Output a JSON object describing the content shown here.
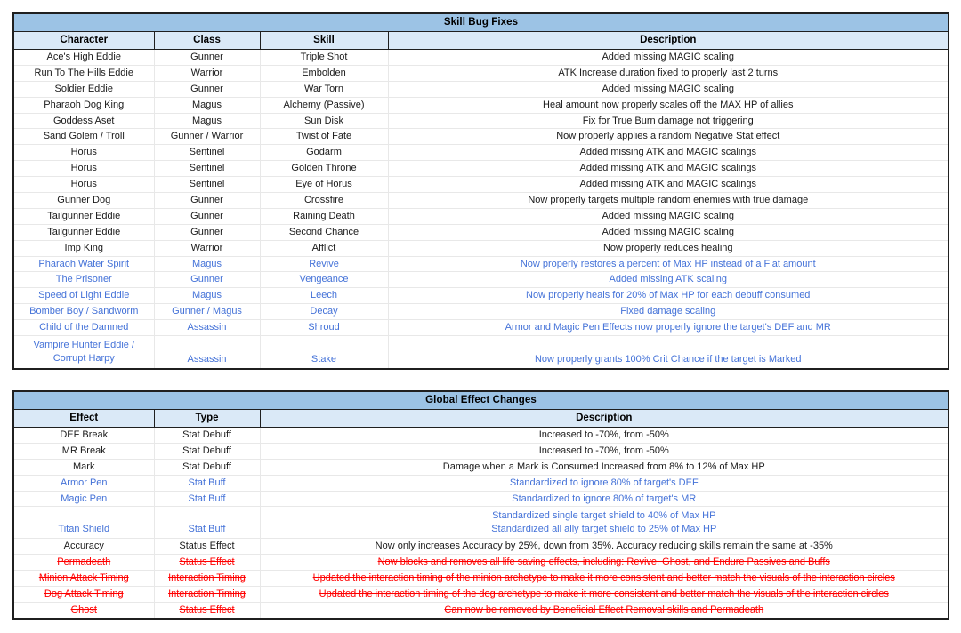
{
  "skill_bug_fixes": {
    "title": "Skill Bug Fixes",
    "columns": [
      "Character",
      "Class",
      "Skill",
      "Description"
    ],
    "rows": [
      {
        "character": "Ace's High Eddie",
        "class": "Gunner",
        "skill": "Triple Shot",
        "description": "Added missing MAGIC scaling",
        "style": "normal"
      },
      {
        "character": "Run To The Hills Eddie",
        "class": "Warrior",
        "skill": "Embolden",
        "description": "ATK Increase duration fixed to properly last 2 turns",
        "style": "normal"
      },
      {
        "character": "Soldier Eddie",
        "class": "Gunner",
        "skill": "War Torn",
        "description": "Added missing MAGIC scaling",
        "style": "normal"
      },
      {
        "character": "Pharaoh Dog King",
        "class": "Magus",
        "skill": "Alchemy (Passive)",
        "description": "Heal amount now properly scales off the MAX HP of allies",
        "style": "normal"
      },
      {
        "character": "Goddess Aset",
        "class": "Magus",
        "skill": "Sun Disk",
        "description": "Fix for True Burn damage not triggering",
        "style": "normal"
      },
      {
        "character": "Sand Golem / Troll",
        "class": "Gunner / Warrior",
        "skill": "Twist of Fate",
        "description": "Now properly applies a random Negative Stat effect",
        "style": "normal"
      },
      {
        "character": "Horus",
        "class": "Sentinel",
        "skill": "Godarm",
        "description": "Added missing ATK and MAGIC scalings",
        "style": "normal"
      },
      {
        "character": "Horus",
        "class": "Sentinel",
        "skill": "Golden Throne",
        "description": "Added missing ATK and MAGIC scalings",
        "style": "normal"
      },
      {
        "character": "Horus",
        "class": "Sentinel",
        "skill": "Eye of Horus",
        "description": "Added missing ATK and MAGIC scalings",
        "style": "normal"
      },
      {
        "character": "Gunner Dog",
        "class": "Gunner",
        "skill": "Crossfire",
        "description": "Now properly targets multiple random enemies with true damage",
        "style": "normal"
      },
      {
        "character": "Tailgunner Eddie",
        "class": "Gunner",
        "skill": "Raining Death",
        "description": "Added missing MAGIC scaling",
        "style": "normal"
      },
      {
        "character": "Tailgunner Eddie",
        "class": "Gunner",
        "skill": "Second Chance",
        "description": "Added missing MAGIC scaling",
        "style": "normal"
      },
      {
        "character": "Imp King",
        "class": "Warrior",
        "skill": "Afflict",
        "description": "Now properly reduces healing",
        "style": "normal"
      },
      {
        "character": "Pharaoh Water Spirit",
        "class": "Magus",
        "skill": "Revive",
        "description": "Now properly restores a percent of Max HP instead of a Flat amount",
        "style": "blue"
      },
      {
        "character": "The Prisoner",
        "class": "Gunner",
        "skill": "Vengeance",
        "description": "Added missing ATK scaling",
        "style": "blue"
      },
      {
        "character": "Speed of Light Eddie",
        "class": "Magus",
        "skill": "Leech",
        "description": "Now properly heals for 20% of Max HP for each debuff consumed",
        "style": "blue"
      },
      {
        "character": "Bomber Boy / Sandworm",
        "class": "Gunner / Magus",
        "skill": "Decay",
        "description": "Fixed damage scaling",
        "style": "blue"
      },
      {
        "character": "Child of the Damned",
        "class": "Assassin",
        "skill": "Shroud",
        "description": "Armor and Magic Pen Effects now properly ignore the target's DEF and MR",
        "style": "blue"
      },
      {
        "character": "Vampire Hunter Eddie /",
        "character_line2": "Corrupt Harpy",
        "class": "Assassin",
        "skill": "Stake",
        "description": "Now properly grants 100% Crit Chance if the target is Marked",
        "style": "blue",
        "tall": true
      }
    ]
  },
  "global_effect_changes": {
    "title": "Global Effect Changes",
    "columns": [
      "Effect",
      "Type",
      "Description"
    ],
    "rows": [
      {
        "effect": "DEF Break",
        "type": "Stat Debuff",
        "description": "Increased to -70%, from -50%",
        "style": "normal"
      },
      {
        "effect": "MR Break",
        "type": "Stat Debuff",
        "description": "Increased to -70%, from -50%",
        "style": "normal"
      },
      {
        "effect": "Mark",
        "type": "Stat Debuff",
        "description": "Damage when a Mark is Consumed Increased from 8% to 12% of Max HP",
        "style": "normal"
      },
      {
        "effect": "Armor Pen",
        "type": "Stat Buff",
        "description": "Standardized to ignore 80% of target's DEF",
        "style": "blue"
      },
      {
        "effect": "Magic Pen",
        "type": "Stat Buff",
        "description": "Standardized to ignore 80% of target's MR",
        "style": "blue"
      },
      {
        "effect": "Titan Shield",
        "type": "Stat Buff",
        "description": "Standardized single target shield to 40% of Max HP",
        "description_line2": "Standardized all ally target shield to 25% of Max HP",
        "style": "blue",
        "tall": true
      },
      {
        "effect": "Accuracy",
        "type": "Status Effect",
        "description": "Now only increases Accuracy by 25%, down from 35%. Accuracy reducing skills remain the same at -35%",
        "style": "normal"
      },
      {
        "effect": "Permadeath",
        "type": "Status Effect",
        "description": "Now blocks and removes all life saving effects, including: Revive, Ghost, and Endure Passives and Buffs",
        "style": "red"
      },
      {
        "effect": "Minion Attack Timing",
        "type": "Interaction Timing",
        "description": "Updated the interaction timing of the minion archetype to make it more consistent and better match the visuals of the interaction circles",
        "style": "red"
      },
      {
        "effect": "Dog Attack Timing",
        "type": "Interaction Timing",
        "description": "Updated the interaction timing of the dog archetype to make it more consistent and better match the visuals of the interaction circles",
        "style": "red"
      },
      {
        "effect": "Ghost",
        "type": "Status Effect",
        "description": "Can now be removed by Beneficial Effect Removal skills and Permadeath",
        "style": "red"
      }
    ]
  },
  "colors": {
    "title_band": "#9cc3e5",
    "header_band": "#dae9f7",
    "blue_text": "#4472d8",
    "red_text": "#ff0000",
    "grid_line": "#e8e8e8",
    "border": "#1f1f1f"
  }
}
